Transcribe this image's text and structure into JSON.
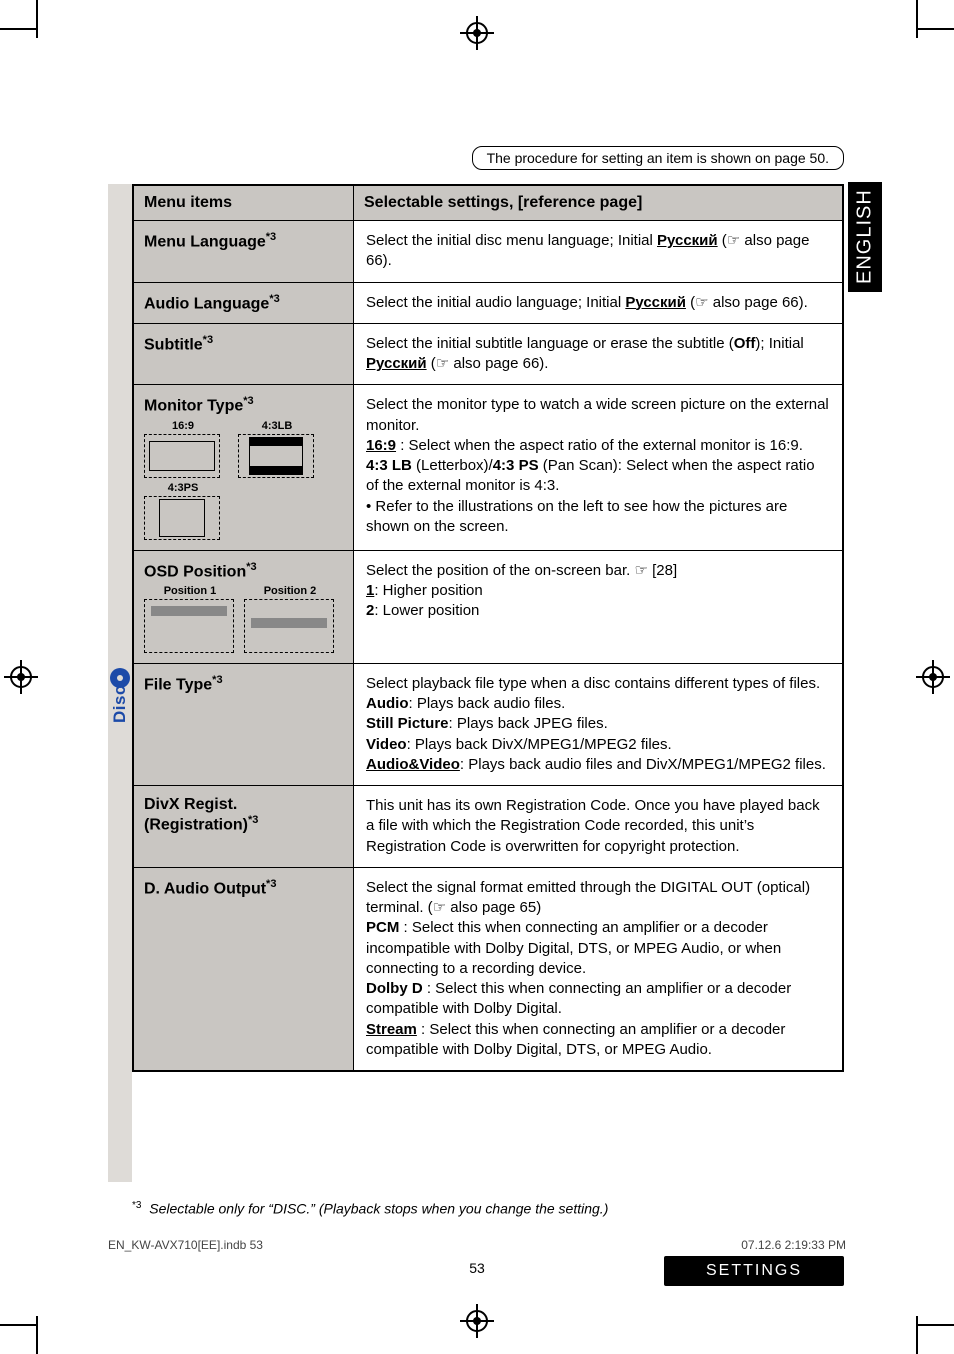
{
  "procedure_note": "The procedure for setting an item is shown on page 50.",
  "side_label": "ENGLISH",
  "disc_label": "Disc",
  "columns": {
    "menu_items": "Menu items",
    "selectable": "Selectable settings, [reference page]"
  },
  "rows": {
    "menu_language": {
      "label": "Menu Language",
      "sup": "*3",
      "body_prefix": "Select the initial disc menu language; Initial ",
      "body_lang": "Русский",
      "body_suffix": " (☞ also page 66)."
    },
    "audio_language": {
      "label": "Audio Language",
      "sup": "*3",
      "body_prefix": "Select the initial audio language; Initial ",
      "body_lang": "Русский",
      "body_suffix": " (☞ also page 66)."
    },
    "subtitle": {
      "label": "Subtitle",
      "sup": "*3",
      "line1_a": "Select the initial subtitle language or erase the subtitle (",
      "off": "Off",
      "line1_b": "); Initial",
      "line2_lang": "Русский",
      "line2_b": " (☞ also page 66)."
    },
    "monitor_type": {
      "label": "Monitor Type",
      "sup": "*3",
      "thumbs": {
        "t169": "16:9",
        "t43lb": "4:3LB",
        "t43ps": "4:3PS"
      },
      "line1": "Select the monitor type to watch a wide screen picture on the external monitor.",
      "line2_key": "16:9",
      "line2_rest": " : Select when the aspect ratio of the external monitor is 16:9.",
      "line3_a": "4:3 LB",
      "line3_mid": " (Letterbox)/",
      "line3_b": "4:3 PS",
      "line3_rest": " (Pan Scan): Select when the aspect ratio of the external monitor is 4:3.",
      "bullet": "Refer to the illustrations on the left to see how the pictures are shown on the screen."
    },
    "osd": {
      "label": "OSD Position",
      "sup": "*3",
      "pos1": "Position 1",
      "pos2": "Position 2",
      "line1": "Select the position of the on-screen bar. ☞ [28]",
      "opt1_key": "1",
      "opt1_rest": ": Higher position",
      "opt2_key": "2",
      "opt2_rest": ": Lower position"
    },
    "file_type": {
      "label": "File Type",
      "sup": "*3",
      "line1": "Select playback file type when a disc contains different types of files.",
      "audio_k": "Audio",
      "audio_r": ": Plays back audio files.",
      "still_k": "Still Picture",
      "still_r": ": Plays back JPEG files.",
      "video_k": "Video",
      "video_r": ": Plays back DivX/MPEG1/MPEG2 files.",
      "av_k": "Audio&Video",
      "av_r": ": Plays back audio files and DivX/MPEG1/MPEG2 files."
    },
    "divx": {
      "label": "DivX Regist. (Registration)",
      "sup": "*3",
      "body": "This unit has its own Registration Code. Once you have played back a file with which the Registration Code recorded, this unit’s Registration Code is overwritten for copyright protection."
    },
    "daudio": {
      "label": "D. Audio Output",
      "sup": "*3",
      "line1": "Select the signal format emitted through the DIGITAL OUT (optical) terminal. (☞ also page 65)",
      "pcm_k": "PCM",
      "pcm_r": " : Select this when connecting an amplifier or a decoder incompatible with Dolby Digital, DTS, or MPEG Audio, or when connecting to a recording device.",
      "dolby_k": "Dolby D",
      "dolby_r": " : Select this when connecting an amplifier or a decoder compatible with Dolby Digital.",
      "stream_k": "Stream",
      "stream_r": " : Select this when connecting an amplifier or a decoder compatible with Dolby Digital, DTS, or MPEG Audio."
    }
  },
  "footnote": {
    "sup": "*3",
    "text": "Selectable only for “DISC.” (Playback stops when you change the setting.)"
  },
  "page_number": "53",
  "settings_label": "SETTINGS",
  "footer_left": "EN_KW-AVX710[EE].indb   53",
  "footer_right": "07.12.6   2:19:33 PM"
}
